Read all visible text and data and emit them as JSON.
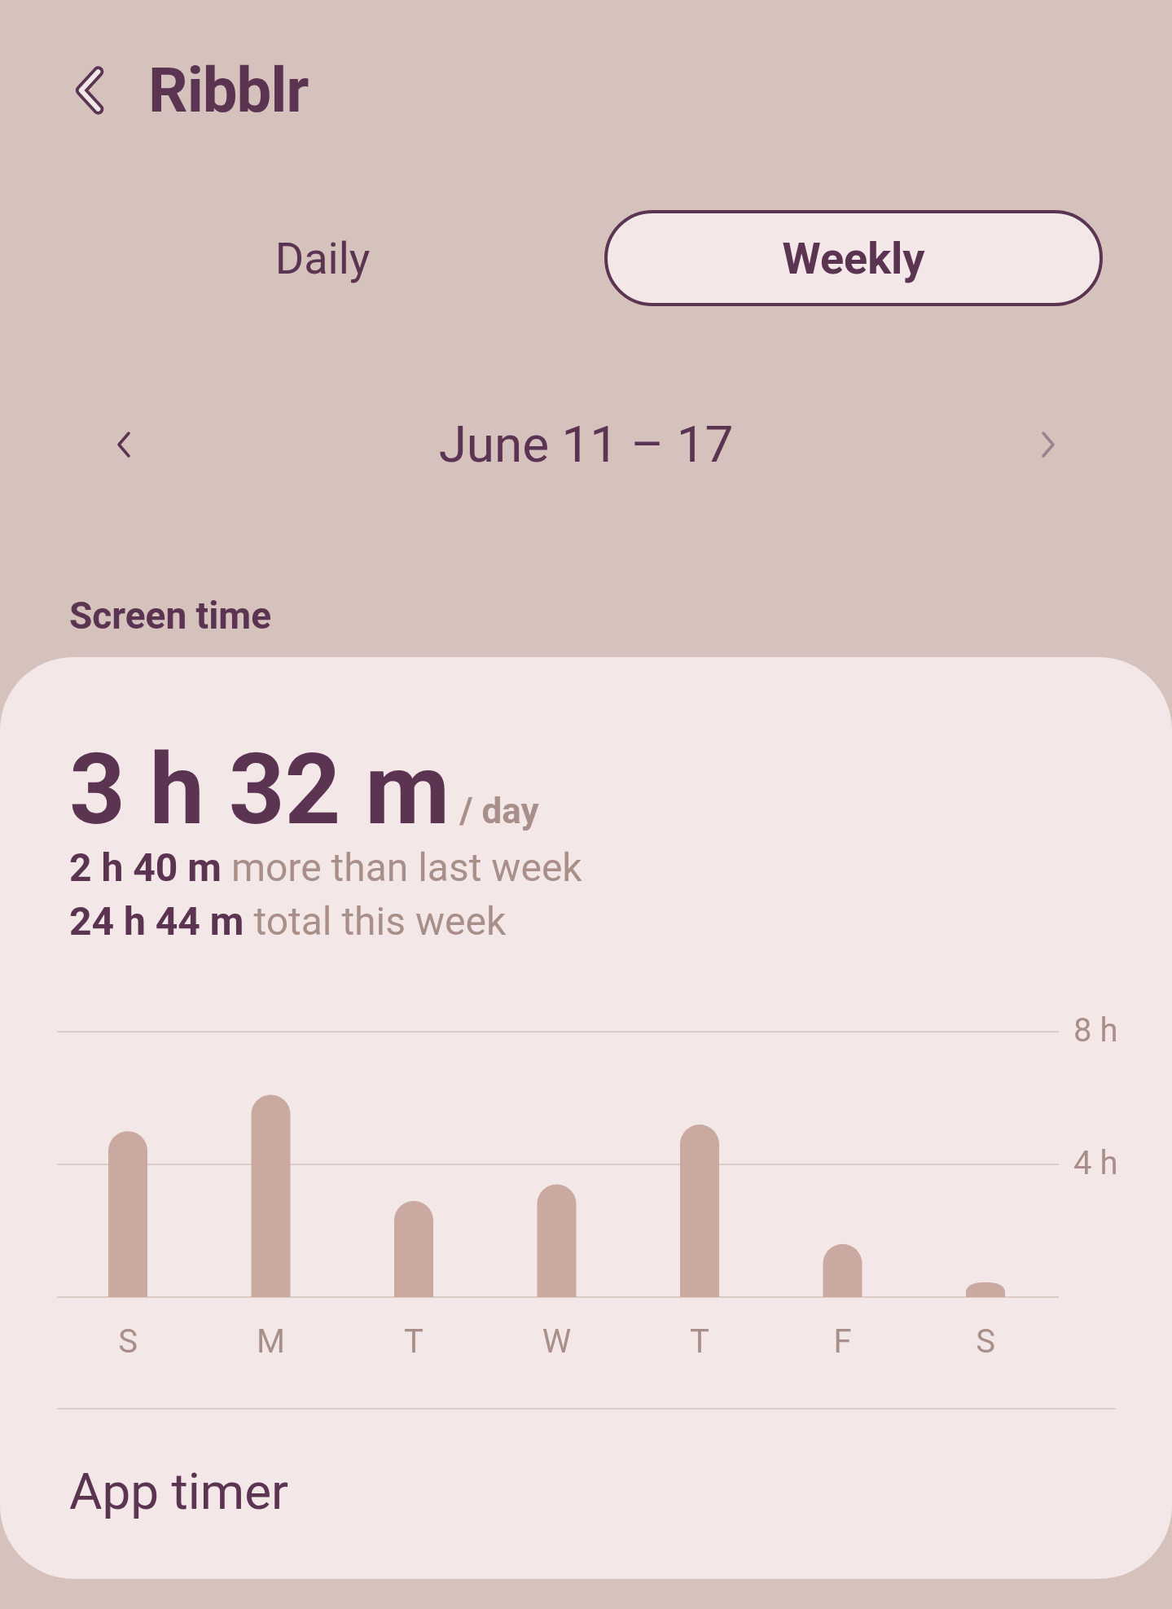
{
  "header": {
    "title": "Ribblr"
  },
  "tabs": [
    {
      "label": "Daily",
      "selected": false
    },
    {
      "label": "Weekly",
      "selected": true
    }
  ],
  "date_range": {
    "label": "June 11 – 17"
  },
  "section_title": "Screen time",
  "summary": {
    "average": "3 h 32 m",
    "unit": "/ day",
    "lines": [
      {
        "value": "2 h 40 m",
        "text": "more than last week"
      },
      {
        "value": "24 h 44 m",
        "text": "total this week"
      }
    ]
  },
  "chart_data": {
    "type": "bar",
    "categories": [
      "S",
      "M",
      "T",
      "W",
      "T",
      "F",
      "S"
    ],
    "series": [
      {
        "color": "#c9a9a0",
        "values": [
          5.0,
          6.1,
          2.9,
          3.4,
          5.2,
          1.6,
          0.45
        ]
      }
    ],
    "ylim": [
      0,
      8
    ],
    "yticks": [
      {
        "value": 4,
        "label": "4 h"
      },
      {
        "value": 8,
        "label": "8 h"
      }
    ]
  },
  "app_timer": {
    "label": "App timer"
  }
}
